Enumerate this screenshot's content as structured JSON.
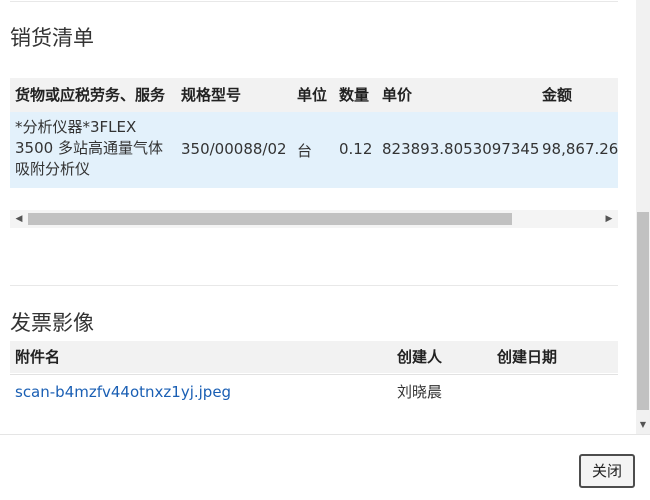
{
  "sales_section": {
    "title": "销货清单",
    "columns": {
      "goods": "货物或应税劳务、服务",
      "spec": "规格型号",
      "unit": "单位",
      "qty": "数量",
      "price": "单价",
      "amount": "金额"
    },
    "rows": [
      {
        "goods_line1": "*分析仪器*3FLEX",
        "goods_line2": "3500 多站高通量气体",
        "goods_line3": "吸附分析仪",
        "spec": "350/00088/02",
        "unit": "台",
        "qty": "0.12",
        "price": "823893.8053097345",
        "amount": "98,867.26"
      }
    ]
  },
  "image_section": {
    "title": "发票影像",
    "columns": {
      "name": "附件名",
      "creator": "创建人",
      "date": "创建日期"
    },
    "rows": [
      {
        "name": "scan-b4mzfv44otnxz1yj.jpeg",
        "creator": "刘晓晨",
        "date": ""
      }
    ]
  },
  "footer": {
    "close_label": "关闭"
  },
  "icons": {
    "scroll_left": "triangle-left",
    "scroll_right": "triangle-right",
    "scroll_down": "triangle-down"
  }
}
